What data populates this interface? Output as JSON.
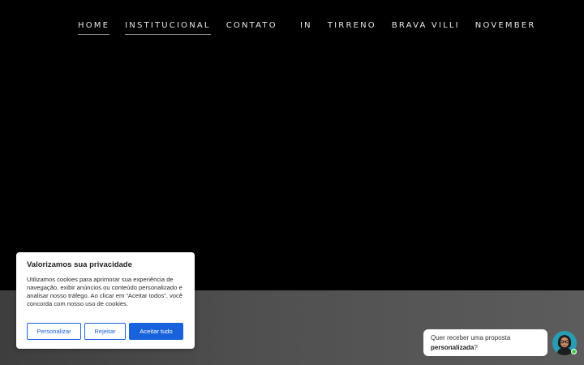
{
  "nav": {
    "left": [
      {
        "label": "HOME"
      },
      {
        "label": "INSTITUCIONAL"
      },
      {
        "label": "CONTATO"
      }
    ],
    "right": [
      {
        "label": "IN"
      },
      {
        "label": "TIRRENO"
      },
      {
        "label": "BRAVA VILLI"
      },
      {
        "label": "NOVEMBER"
      }
    ]
  },
  "cookie": {
    "title": "Valorizamos sua privacidade",
    "text": "Utilizamos cookies para aprimorar sua experiência de navegação, exibir anúncios ou conteúdo personalizado e analisar nosso tráfego. Ao clicar em “Aceitar todos”, você concorda com nosso uso de cookies.",
    "customize_label": "Personalizar",
    "reject_label": "Rejeitar",
    "accept_label": "Aceitar tudo"
  },
  "chat": {
    "prompt_text": "Quer receber uma proposta",
    "prompt_bold": "personalizada",
    "prompt_suffix": "?",
    "avatar_icon": "agent-avatar-icon"
  },
  "colors": {
    "accent": "#1863dc",
    "online": "#3ecf4a"
  }
}
